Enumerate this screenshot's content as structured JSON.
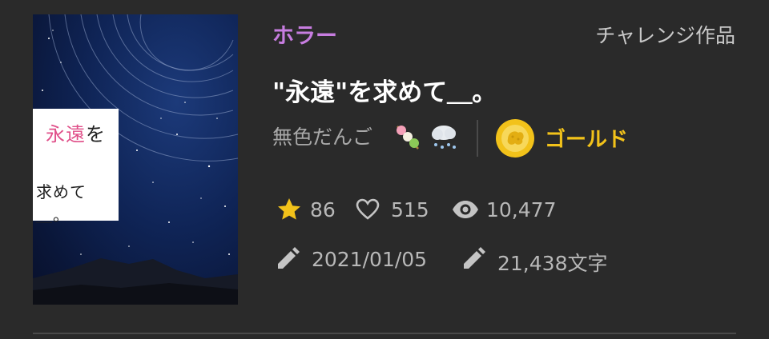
{
  "work": {
    "genre": "ホラー",
    "badge": "チャレンジ作品",
    "title": "\"永遠\"を求めて＿。",
    "cover": {
      "line1_pink": "永遠",
      "line1_dark": "を",
      "line2": "求めて＿。"
    },
    "author": "無色だんご",
    "author_emojis": [
      "dango-icon",
      "snow-cloud-icon"
    ],
    "rank": "ゴールド",
    "stars": "86",
    "likes": "515",
    "views": "10,477",
    "updated": "2021/01/05",
    "length": "21,438文字"
  },
  "colors": {
    "genre": "#c77de0",
    "gold": "#f2c21a",
    "background": "#2a2a2a"
  }
}
